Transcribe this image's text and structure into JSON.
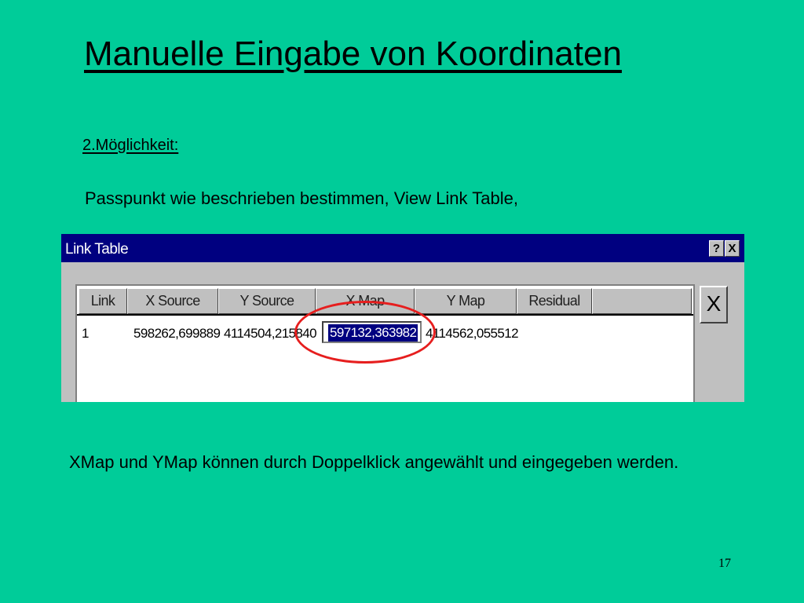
{
  "slide": {
    "title": "Manuelle Eingabe von Koordinaten",
    "subtitle": "2.Möglichkeit:",
    "intro": "Passpunkt wie beschrieben bestimmen, View Link Table,",
    "note": "XMap und YMap können durch Doppelklick angewählt und eingegeben werden.",
    "page_number": "17",
    "background_color": "#00cc99",
    "highlight_color": "#e61e1e"
  },
  "window": {
    "title": "Link Table",
    "help_label": "?",
    "close_label": "X",
    "delete_label": "X",
    "titlebar_color": "#000080",
    "columns": [
      "Link",
      "X Source",
      "Y Source",
      "X Map",
      "Y Map",
      "Residual"
    ],
    "rows": [
      {
        "link": "1",
        "x_source": "598262,699889",
        "y_source": "4114504,215840",
        "x_map": "597132,363982",
        "y_map": "4114562,055512",
        "residual": ""
      }
    ],
    "editing_cell": "x_map"
  }
}
